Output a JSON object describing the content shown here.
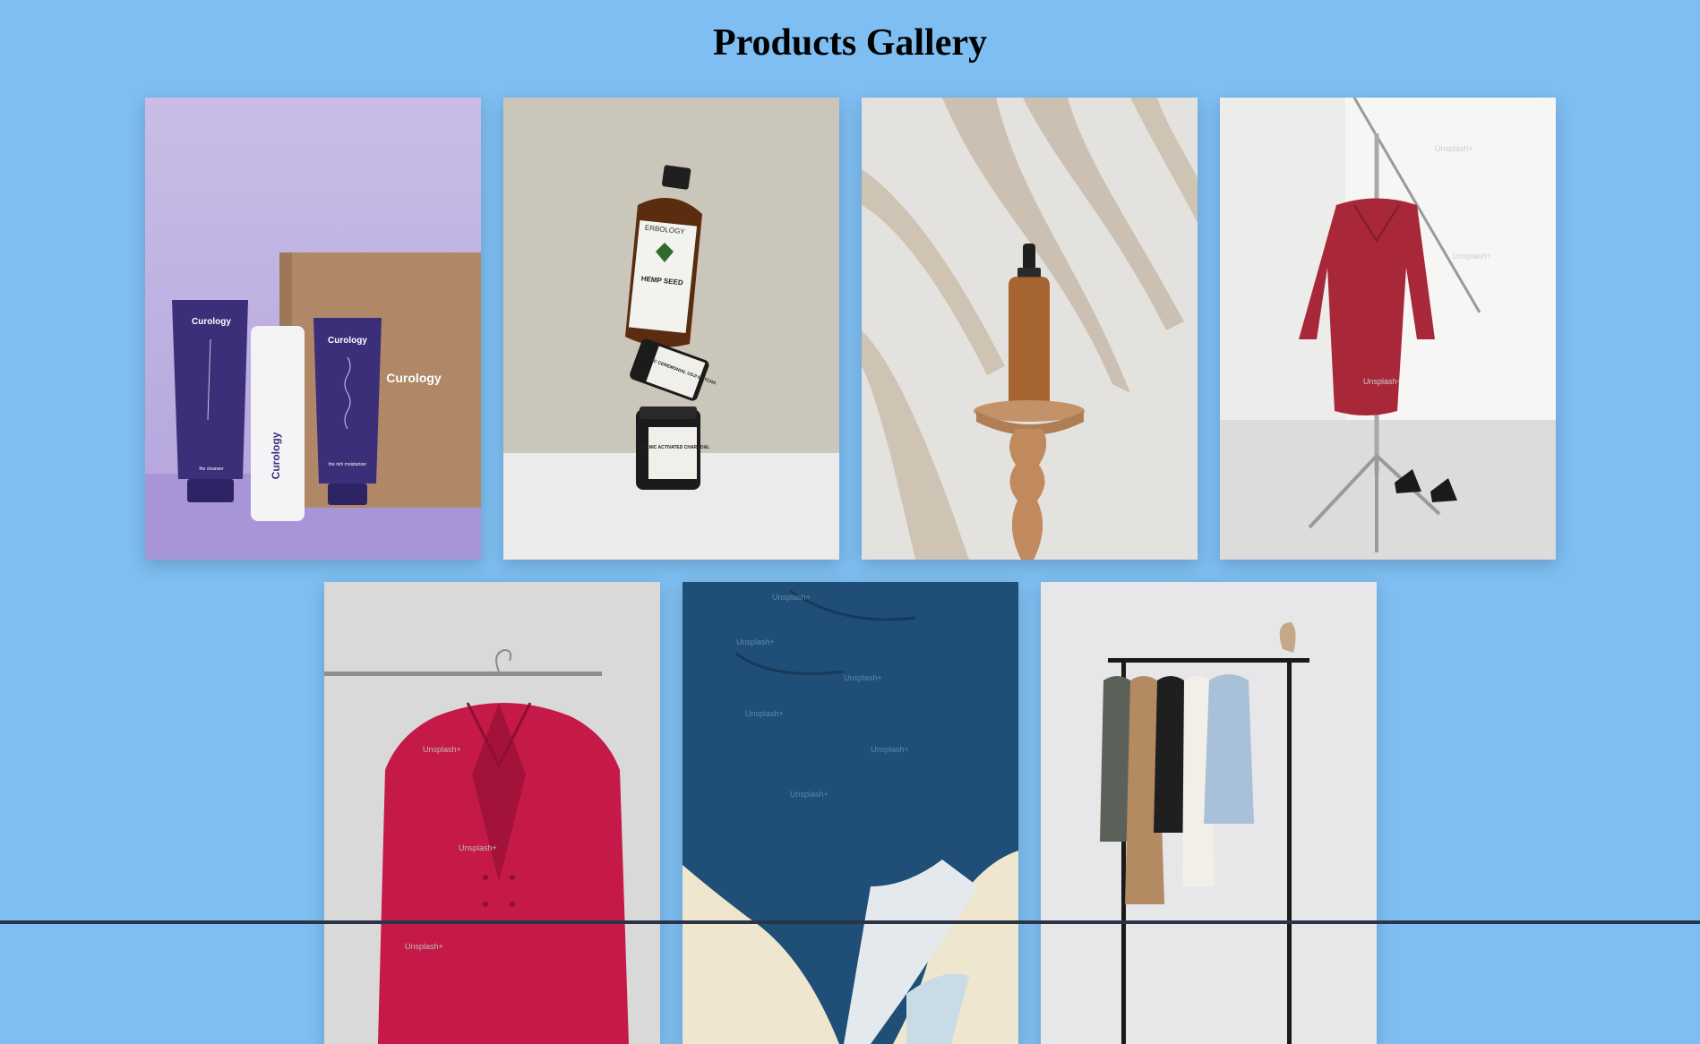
{
  "page": {
    "title": "Products Gallery"
  },
  "colors": {
    "background": "#7ebef2",
    "title": "#000000"
  },
  "gallery": {
    "rows": [
      {
        "items": [
          {
            "id": "skincare-box",
            "brand": "Curology",
            "tube1_label": "Curology",
            "tube1_sub": "the cleanser",
            "bottle_label": "Curology",
            "tube2_label": "Curology",
            "tube2_sub": "the rich moisturizer"
          },
          {
            "id": "stacked-jars",
            "bottle_brand": "ERBOLOGY",
            "bottle_label": "HEMP SEED",
            "jar1_label": "ORGANIC CEREMONIAL USJI MATCHA",
            "jar2_label": "ORGANIC ACTIVATED CHARCOAL"
          },
          {
            "id": "dropper-bottle"
          },
          {
            "id": "red-dress-stand",
            "watermark": "Unsplash+"
          }
        ]
      },
      {
        "items": [
          {
            "id": "red-blazer",
            "watermark": "Unsplash+"
          },
          {
            "id": "denim-jacket",
            "watermark": "Unsplash+"
          },
          {
            "id": "clothing-rack"
          }
        ]
      }
    ]
  }
}
